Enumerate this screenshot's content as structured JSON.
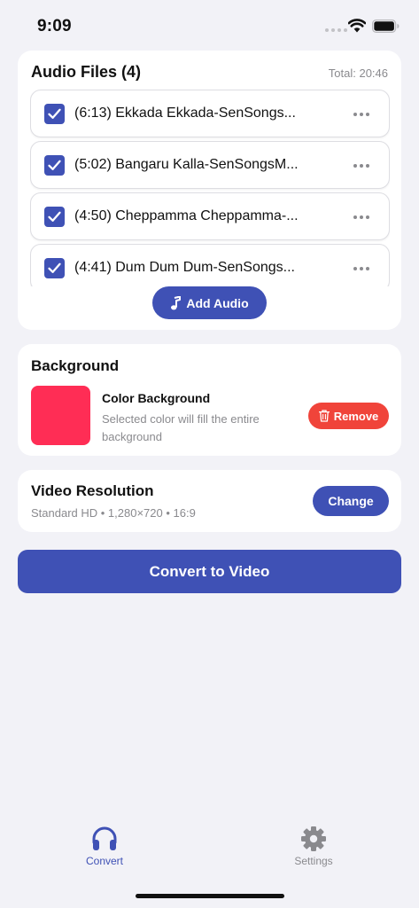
{
  "status_bar": {
    "time": "9:09"
  },
  "audio_files": {
    "title": "Audio Files (4)",
    "total": "Total: 20:46",
    "items": [
      {
        "label": "(6:13) Ekkada Ekkada-SenSongs...",
        "checked": true
      },
      {
        "label": "(5:02) Bangaru Kalla-SenSongsM...",
        "checked": true
      },
      {
        "label": "(4:50) Cheppamma Cheppamma-...",
        "checked": true
      },
      {
        "label": "(4:41) Dum Dum Dum-SenSongs...",
        "checked": true
      }
    ],
    "add_button_label": "Add Audio",
    "add_button_icon": "music-note-icon"
  },
  "background": {
    "title": "Background",
    "swatch_color": "#ff2d55",
    "option_label": "Color Background",
    "description": "Selected color will fill the entire background",
    "remove_label": "Remove",
    "remove_icon": "trash-icon"
  },
  "resolution": {
    "title": "Video Resolution",
    "subtitle": "Standard HD • 1,280×720 • 16:9",
    "change_label": "Change"
  },
  "convert_button_label": "Convert to Video",
  "tab_bar": {
    "tabs": [
      {
        "label": "Convert",
        "icon": "headphones-icon",
        "active": true
      },
      {
        "label": "Settings",
        "icon": "gear-icon",
        "active": false
      }
    ]
  },
  "colors": {
    "accent": "#3f51b5",
    "destructive": "#f0443a",
    "background": "#f2f2f7",
    "secondary_text": "#8a8a8e"
  }
}
